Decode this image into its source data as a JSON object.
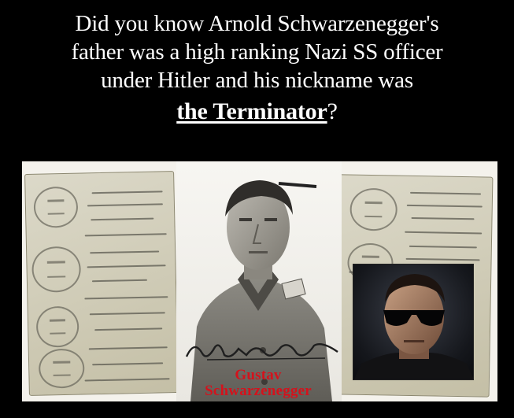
{
  "caption": {
    "line1": "Did you know Arnold Schwarzenegger's",
    "line2": "father was a high ranking Nazi SS officer",
    "line3": "under Hitler and his nickname was",
    "emphasis": "the Terminator",
    "trailing": "?"
  },
  "photo_label": {
    "first_name": "Gustav",
    "last_name": "Schwarzenegger"
  },
  "colors": {
    "background": "#000000",
    "caption_text": "#ffffff",
    "name_label": "#d4121c"
  }
}
